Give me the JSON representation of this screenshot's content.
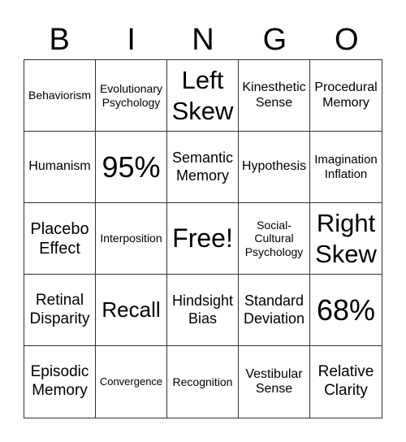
{
  "header": {
    "letters": [
      "B",
      "I",
      "N",
      "G",
      "O"
    ]
  },
  "cells": [
    "Behaviorism",
    "Evolutionary Psychology",
    "Left Skew",
    "Kinesthetic Sense",
    "Procedural Memory",
    "Humanism",
    "95%",
    "Semantic Memory",
    "Hypothesis",
    "Imagination Inflation",
    "Placebo Effect",
    "Interposition",
    "Free!",
    "Social-Cultural Psychology",
    "Right Skew",
    "Retinal Disparity",
    "Recall",
    "Hindsight Bias",
    "Standard Deviation",
    "68%",
    "Episodic Memory",
    "Convergence",
    "Recognition",
    "Vestibular Sense",
    "Relative Clarity"
  ]
}
